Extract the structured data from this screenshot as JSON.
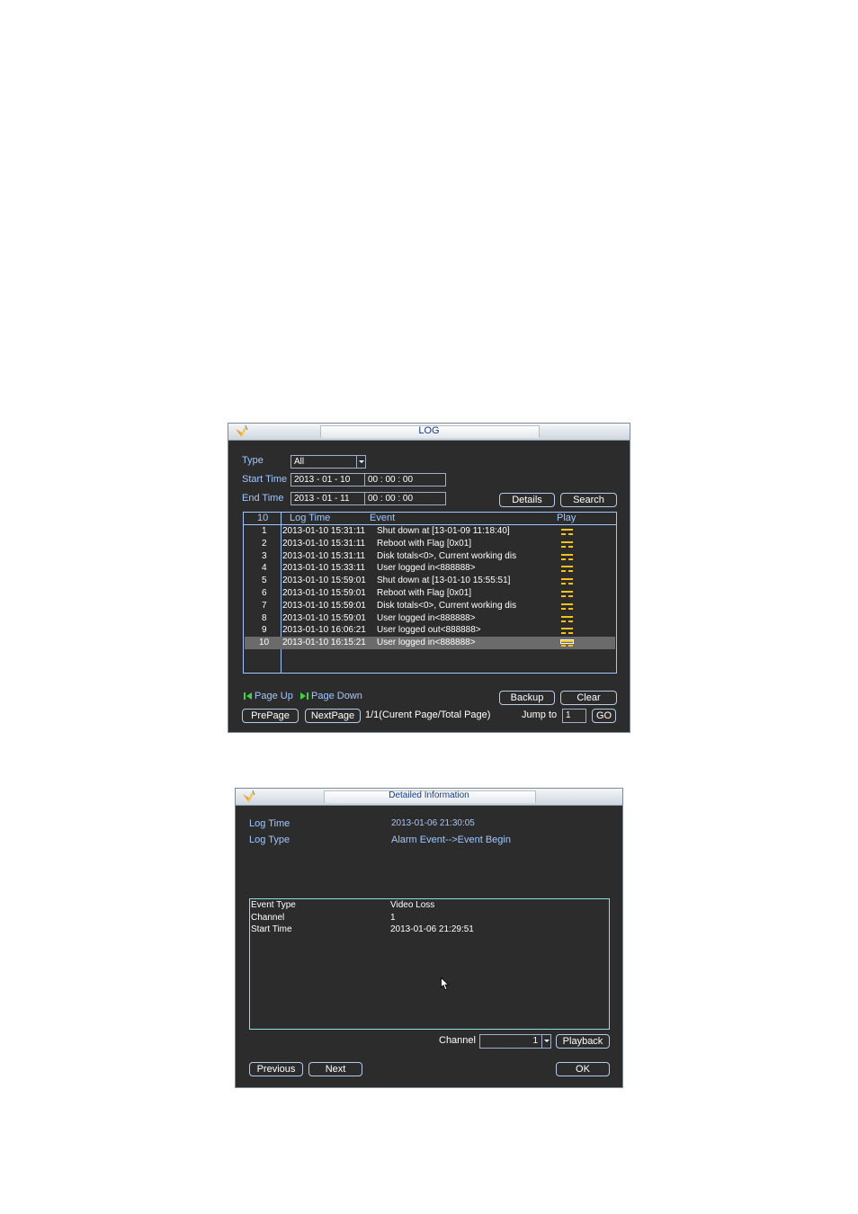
{
  "log_window": {
    "title": "LOG",
    "type_label": "Type",
    "type_value": "All",
    "start_time_label": "Start Time",
    "start_date": "2013  -  01 - 10",
    "start_clock": "00  :  00  :  00",
    "end_time_label": "End Time",
    "end_date": "2013  -  01 - 11",
    "end_clock": "00  :  00  :  00",
    "details_label": "Details",
    "search_label": "Search",
    "columns": {
      "count": "10",
      "log_time": "Log Time",
      "event": "Event",
      "play": "Play"
    },
    "rows": [
      {
        "no": "1",
        "time": "2013-01-10 15:31:11",
        "event": "Shut down at [13-01-09 11:18:40]"
      },
      {
        "no": "2",
        "time": "2013-01-10 15:31:11",
        "event": "Reboot with Flag [0x01]"
      },
      {
        "no": "3",
        "time": "2013-01-10 15:31:11",
        "event": "Disk totals<0>, Current working dis"
      },
      {
        "no": "4",
        "time": "2013-01-10 15:33:11",
        "event": "User logged in<888888>"
      },
      {
        "no": "5",
        "time": "2013-01-10 15:59:01",
        "event": "Shut down at [13-01-10 15:55:51]"
      },
      {
        "no": "6",
        "time": "2013-01-10 15:59:01",
        "event": "Reboot with Flag [0x01]"
      },
      {
        "no": "7",
        "time": "2013-01-10 15:59:01",
        "event": "Disk totals<0>, Current working dis"
      },
      {
        "no": "8",
        "time": "2013-01-10 15:59:01",
        "event": "User logged in<888888>"
      },
      {
        "no": "9",
        "time": "2013-01-10 16:06:21",
        "event": "User logged out<888888>"
      },
      {
        "no": "10",
        "time": "2013-01-10 16:15:21",
        "event": "User logged in<888888>"
      }
    ],
    "page_up_label": "Page Up",
    "page_down_label": "Page Down",
    "backup_label": "Backup",
    "clear_label": "Clear",
    "prepage_label": "PrePage",
    "nextpage_label": "NextPage",
    "page_info": "1/1(Curent Page/Total Page)",
    "jump_to_label": "Jump to",
    "jump_value": "1",
    "go_label": "GO"
  },
  "detail_window": {
    "title": "Detailed Information",
    "log_time_label": "Log Time",
    "log_time_value": "2013-01-06 21:30:05",
    "log_type_label": "Log Type",
    "log_type_value": "Alarm Event-->Event Begin",
    "info": [
      {
        "key": "Event Type",
        "value": "Video Loss"
      },
      {
        "key": "Channel",
        "value": "1"
      },
      {
        "key": "Start Time",
        "value": "2013-01-06 21:29:51"
      }
    ],
    "channel_label": "Channel",
    "channel_value": "1",
    "playback_label": "Playback",
    "previous_label": "Previous",
    "next_label": "Next",
    "ok_label": "OK"
  },
  "colors": {
    "panel_bg": "#2c2c2c",
    "label_blue": "#9fc7ff",
    "play_icon": "#f4c21e",
    "page_arrow": "#3fd43f"
  }
}
